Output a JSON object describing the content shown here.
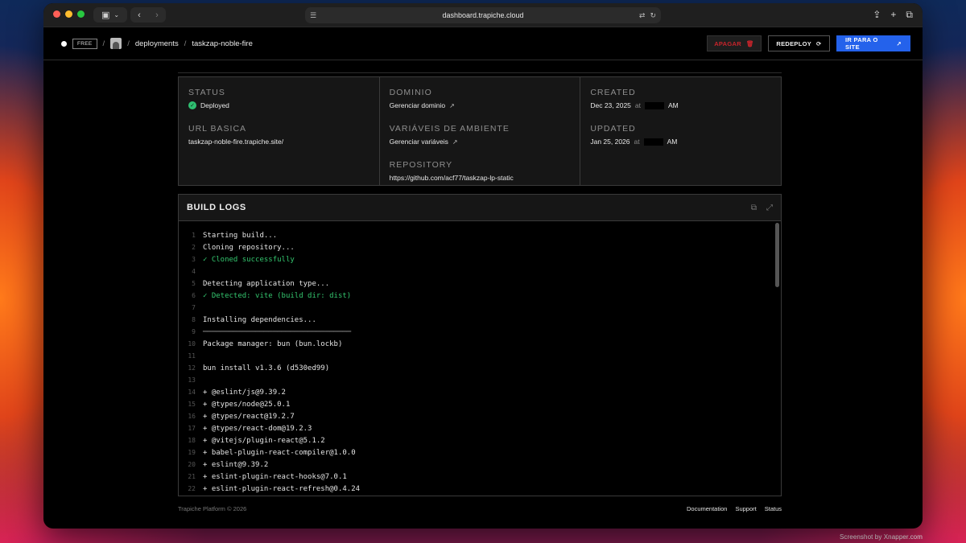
{
  "browser": {
    "url": "dashboard.trapiche.cloud"
  },
  "header": {
    "plan_badge": "FREE",
    "crumb_deployments": "deployments",
    "crumb_project": "taskzap-noble-fire",
    "delete_label": "APAGAR",
    "redeploy_label": "REDEPLOY",
    "site_label": "IR PARA O SITE"
  },
  "info": {
    "status_label": "STATUS",
    "status_value": "Deployed",
    "url_label": "URL BASICA",
    "url_value": "taskzap-noble-fire.trapiche.site/",
    "domain_label": "DOMINIO",
    "domain_value": "Gerenciar dominio",
    "env_label": "VARIÁVEIS DE AMBIENTE",
    "env_value": "Gerenciar variáveis",
    "repo_label": "REPOSITORY",
    "repo_value": "https://github.com/acf77/taskzap-lp-static",
    "created_label": "CREATED",
    "created_date": "Dec 23, 2025",
    "created_at": "at",
    "created_ampm": "AM",
    "updated_label": "UPDATED",
    "updated_date": "Jan 25, 2026",
    "updated_at": "at",
    "updated_ampm": "AM"
  },
  "logs": {
    "title": "BUILD LOGS",
    "lines": [
      {
        "n": "1",
        "t": "Starting build...",
        "kind": ""
      },
      {
        "n": "2",
        "t": "Cloning repository...",
        "kind": ""
      },
      {
        "n": "3",
        "t": "✓ Cloned successfully",
        "kind": "ok"
      },
      {
        "n": "4",
        "t": "",
        "kind": ""
      },
      {
        "n": "5",
        "t": "Detecting application type...",
        "kind": ""
      },
      {
        "n": "6",
        "t": "✓ Detected: vite (build dir: dist)",
        "kind": "ok"
      },
      {
        "n": "7",
        "t": "",
        "kind": ""
      },
      {
        "n": "8",
        "t": "Installing dependencies...",
        "kind": ""
      },
      {
        "n": "9",
        "t": "──────────────────────────────────",
        "kind": "rule"
      },
      {
        "n": "10",
        "t": "Package manager: bun (bun.lockb)",
        "kind": ""
      },
      {
        "n": "11",
        "t": "",
        "kind": ""
      },
      {
        "n": "12",
        "t": "bun install v1.3.6 (d530ed99)",
        "kind": ""
      },
      {
        "n": "13",
        "t": "",
        "kind": ""
      },
      {
        "n": "14",
        "t": "+ @eslint/js@9.39.2",
        "kind": ""
      },
      {
        "n": "15",
        "t": "+ @types/node@25.0.1",
        "kind": ""
      },
      {
        "n": "16",
        "t": "+ @types/react@19.2.7",
        "kind": ""
      },
      {
        "n": "17",
        "t": "+ @types/react-dom@19.2.3",
        "kind": ""
      },
      {
        "n": "18",
        "t": "+ @vitejs/plugin-react@5.1.2",
        "kind": ""
      },
      {
        "n": "19",
        "t": "+ babel-plugin-react-compiler@1.0.0",
        "kind": ""
      },
      {
        "n": "20",
        "t": "+ eslint@9.39.2",
        "kind": ""
      },
      {
        "n": "21",
        "t": "+ eslint-plugin-react-hooks@7.0.1",
        "kind": ""
      },
      {
        "n": "22",
        "t": "+ eslint-plugin-react-refresh@0.4.24",
        "kind": ""
      }
    ]
  },
  "footer": {
    "copyright": "Trapiche Platform © 2026",
    "link_docs": "Documentation",
    "link_support": "Support",
    "link_status": "Status"
  },
  "credit": "Screenshot by Xnapper.com",
  "colors": {
    "accent_blue": "#2462eb",
    "danger_red": "#c9242b",
    "success_green": "#34c76f"
  }
}
